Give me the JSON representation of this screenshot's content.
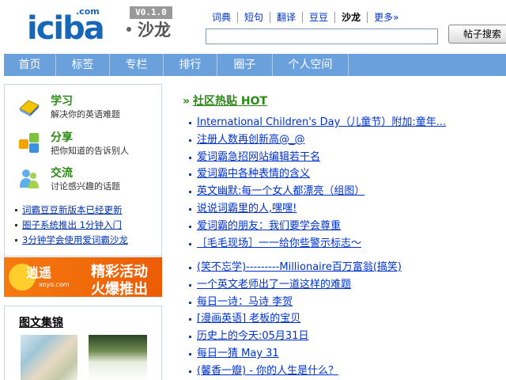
{
  "header": {
    "logo_text": "iciba",
    "logo_com": ".com",
    "salon_label": "沙龙",
    "version": "V0.1.0"
  },
  "topnav": [
    {
      "label": "词典",
      "active": false
    },
    {
      "label": "短句",
      "active": false
    },
    {
      "label": "翻译",
      "active": false
    },
    {
      "label": "豆豆",
      "active": false
    },
    {
      "label": "沙龙",
      "active": true
    },
    {
      "label": "更多»",
      "active": false
    }
  ],
  "search": {
    "value": "",
    "button_label": "帖子搜索"
  },
  "mainnav": [
    {
      "label": "首页"
    },
    {
      "label": "标签"
    },
    {
      "label": "专栏"
    },
    {
      "label": "排行"
    },
    {
      "label": "圈子"
    },
    {
      "label": "个人空间"
    }
  ],
  "features": [
    {
      "title": "学习",
      "desc": "解决你的英语难题",
      "icon": "study-icon"
    },
    {
      "title": "分享",
      "desc": "把你知道的告诉别人",
      "icon": "share-icon"
    },
    {
      "title": "交流",
      "desc": "讨论感兴趣的话题",
      "icon": "people-icon"
    }
  ],
  "left_links": [
    "词霸豆豆新版本已经更新",
    "圈子系统推出 1分钟入门",
    "3分钟学会使用爱词霸沙龙"
  ],
  "banner": {
    "logo_text": "逍遥",
    "logo_sub": "xoyo.com",
    "line1": "精彩活动",
    "line2": "火爆推出"
  },
  "gallery": {
    "title": "图文集锦"
  },
  "hot": {
    "chevron": "»",
    "title": "社区热贴  HOT",
    "group_a": [
      "International Children's Day（儿童节）附加:童年...",
      "注册人数再创新高@_@",
      "爱词霸急招网站编辑若干名",
      "爱词霸中各种表情的含义",
      "英文幽默:每一个女人都漂亮（组图）",
      "说说词霸里的人,嘿嘿!",
      "爱词霸的朋友：我们要学会尊重",
      "［毛毛现场］一一给你些警示标志～"
    ],
    "group_b": [
      "(笑不忘学)---------Millionaire百万富翁(搞笑)",
      "一个英文老师出了一道这样的难题",
      "每日一诗：马诗  李贺",
      "[漫画英语] 老板的宝贝",
      "历史上的今天:05月31日",
      "每日一猜  May 31",
      "(馨香一瓣) - 你的人生是什么？"
    ]
  },
  "colors": {
    "nav_blue": "#6aa0dc",
    "link_blue": "#0033cc",
    "green": "#2a8a14",
    "banner_orange": "#f57a10"
  }
}
